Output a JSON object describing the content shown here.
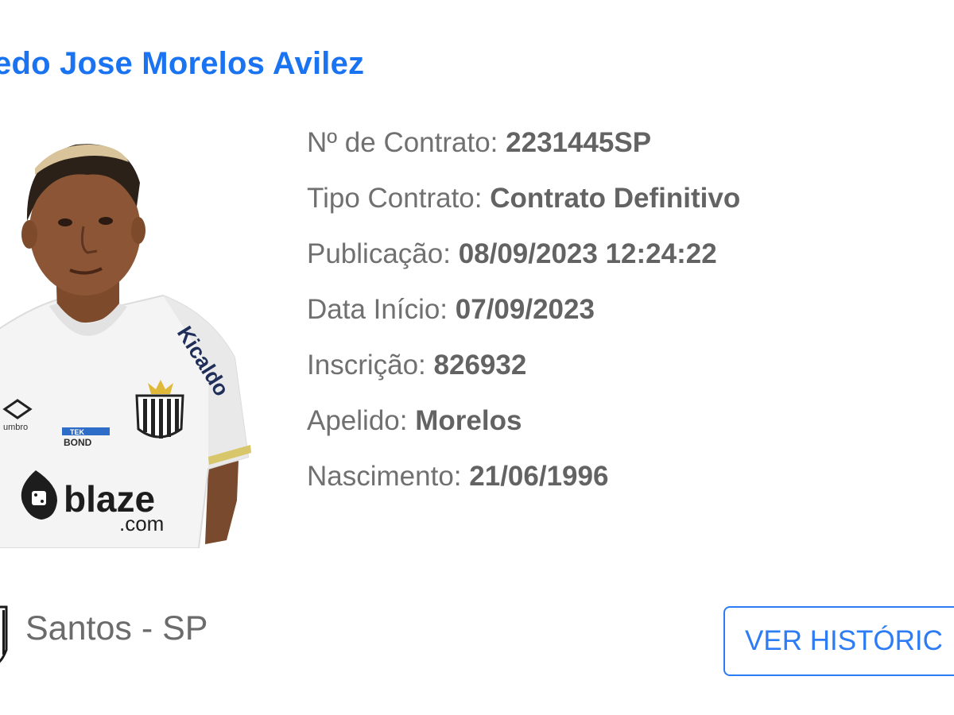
{
  "player": {
    "name": "edo Jose Morelos Avilez"
  },
  "contract": {
    "numero_label": "Nº de Contrato:",
    "numero_value": "2231445SP",
    "tipo_label": "Tipo Contrato:",
    "tipo_value": "Contrato Definitivo",
    "publicacao_label": "Publicação:",
    "publicacao_value": "08/09/2023 12:24:22",
    "inicio_label": "Data Início:",
    "inicio_value": "07/09/2023",
    "inscricao_label": "Inscrição:",
    "inscricao_value": "826932",
    "apelido_label": "Apelido:",
    "apelido_value": "Morelos",
    "nascimento_label": "Nascimento:",
    "nascimento_value": "21/06/1996"
  },
  "club": {
    "name": "Santos - SP",
    "crest_icon": "santos-crest-icon"
  },
  "actions": {
    "history_label": "VER HISTÓRIC"
  },
  "shirt": {
    "sponsor_main": "blaze",
    "sponsor_sub": ".com",
    "sleeve_text": "Kicaldo",
    "badge_top": "TEK",
    "badge_bottom": "BOND",
    "maker_text": "umbro"
  },
  "colors": {
    "name": "#1a73f0",
    "label": "#707070",
    "value": "#636363",
    "button": "#2d7cf6"
  }
}
